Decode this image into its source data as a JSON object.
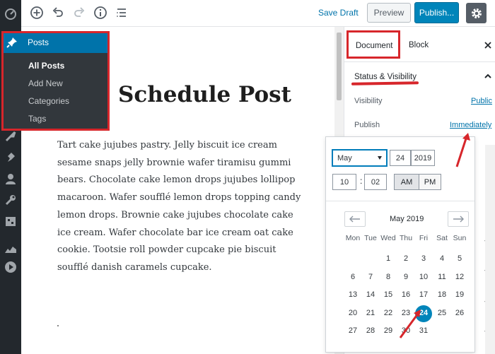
{
  "toolbar": {
    "save_draft": "Save Draft",
    "preview": "Preview",
    "publish": "Publish..."
  },
  "admin_menu": {
    "posts_label": "Posts",
    "submenu": [
      "All Posts",
      "Add New",
      "Categories",
      "Tags"
    ]
  },
  "editor": {
    "title": "Schedule Post",
    "body": "Tart cake jujubes pastry. Jelly biscuit ice cream sesame snaps jelly brownie wafer tiramisu gummi bears. Chocolate cake lemon drops jujubes lollipop macaroon. Wafer soufflé lemon drops topping candy lemon drops. Brownie cake jujubes chocolate cake ice cream. Wafer chocolate bar ice cream oat cake cookie. Tootsie roll powder cupcake pie biscuit soufflé danish caramels cupcake."
  },
  "sidebar": {
    "tab_document": "Document",
    "tab_block": "Block",
    "status_title": "Status & Visibility",
    "visibility_label": "Visibility",
    "visibility_value": "Public",
    "publish_label": "Publish",
    "publish_value": "Immediately"
  },
  "datepicker": {
    "month": "May",
    "day": "24",
    "year": "2019",
    "hour": "10",
    "minute": "02",
    "am": "AM",
    "pm": "PM",
    "month_title": "May 2019",
    "weekdays": [
      "Mon",
      "Tue",
      "Wed",
      "Thu",
      "Fri",
      "Sat",
      "Sun"
    ],
    "weeks": [
      [
        "",
        "",
        "1",
        "2",
        "3",
        "4",
        "5"
      ],
      [
        "6",
        "7",
        "8",
        "9",
        "10",
        "11",
        "12"
      ],
      [
        "13",
        "14",
        "15",
        "16",
        "17",
        "18",
        "19"
      ],
      [
        "20",
        "21",
        "22",
        "23",
        "24",
        "25",
        "26"
      ],
      [
        "27",
        "28",
        "29",
        "30",
        "31",
        "",
        ""
      ]
    ],
    "selected_day": "24"
  },
  "colors": {
    "admin_dark": "#23282d",
    "accent_blue": "#0085ba",
    "highlight_red": "#d7262b"
  },
  "icons": [
    "dashboard-icon",
    "posts-pin-icon",
    "media-icon",
    "pages-icon",
    "comments-icon",
    "appearance-icon",
    "plugins-icon",
    "users-icon",
    "tools-icon",
    "settings-icon",
    "stats-icon",
    "play-icon",
    "add-block-icon",
    "undo-icon",
    "redo-icon",
    "info-icon",
    "outline-icon",
    "gear-icon",
    "close-icon",
    "chevron-up-icon",
    "check-icon",
    "arrow-left-icon",
    "arrow-right-icon"
  ]
}
